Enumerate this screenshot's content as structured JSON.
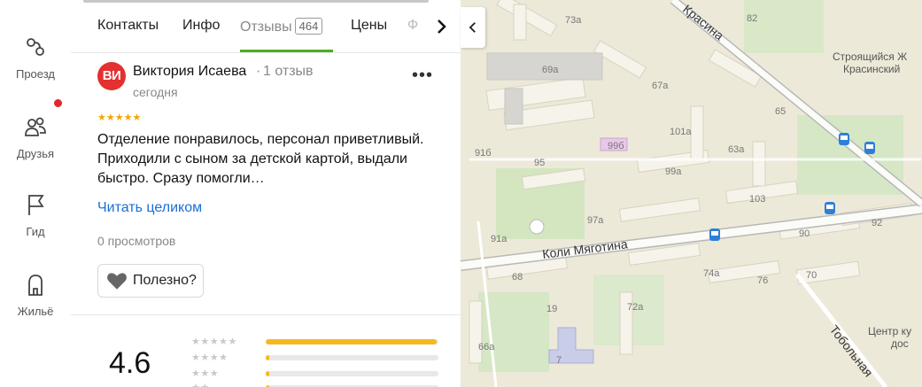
{
  "rail": {
    "items": [
      {
        "icon": "route-icon",
        "label": "Проезд"
      },
      {
        "icon": "friends-icon",
        "label": "Друзья"
      },
      {
        "icon": "flag-icon",
        "label": "Гид"
      },
      {
        "icon": "housing-icon",
        "label": "Жильё"
      }
    ]
  },
  "tabs": {
    "contacts": "Контакты",
    "info": "Инфо",
    "reviews": "Отзывы",
    "reviews_count": "464",
    "prices": "Цены",
    "more": "Ф"
  },
  "review": {
    "avatar_initials": "ВИ",
    "author": "Виктория Исаева",
    "separator": "·",
    "author_reviews": "1 отзыв",
    "date": "сегодня",
    "stars": "★★★★★",
    "text": "Отделение понравилось, персонал приветливый. Приходили с сыном за детской картой, выдали быстро. Сразу помогли…",
    "read_more": "Читать целиком",
    "views": "0 просмотров",
    "useful_label": "Полезно?"
  },
  "rating": {
    "value": "4.6",
    "rows": [
      {
        "stars": "★★★★★",
        "fraction": 0.99
      },
      {
        "stars": "★★★★",
        "fraction": 0.02
      },
      {
        "stars": "★★★",
        "fraction": 0.02
      },
      {
        "stars": "★★",
        "fraction": 0.02
      }
    ]
  },
  "map": {
    "streets": [
      "Красина",
      "Коли Мяготина",
      "Тобольная"
    ],
    "houses": [
      "73а",
      "82",
      "69а",
      "67а",
      "65",
      "91б",
      "101а",
      "99б",
      "63а",
      "95",
      "99а",
      "97а",
      "103",
      "91а",
      "90",
      "92",
      "68",
      "74а",
      "76",
      "70",
      "19",
      "72а",
      "66а",
      "7"
    ],
    "pois": [
      "Строящийся Ж",
      "Красинский",
      "Центр ку",
      "дос"
    ]
  },
  "colors": {
    "accent": "#4caf1f",
    "link": "#1a6ed8",
    "star": "#f5a500",
    "avatar": "#e33030",
    "notify": "#e3262f"
  }
}
